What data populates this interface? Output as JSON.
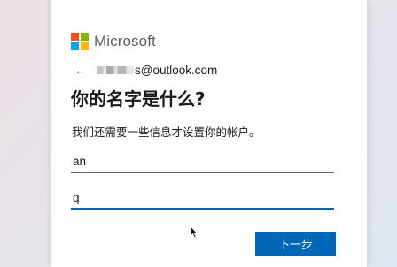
{
  "brand": {
    "name": "Microsoft",
    "logo_colors": [
      "#f25022",
      "#7fba00",
      "#00a4ef",
      "#ffb900"
    ]
  },
  "identity": {
    "back_icon": "←",
    "email_visible": "s@outlook.com"
  },
  "form": {
    "title": "你的名字是什么?",
    "subtitle": "我们还需要一些信息才设置你的帐户。",
    "last_name_value": "an",
    "first_name_value": "q"
  },
  "actions": {
    "next_label": "下一步"
  },
  "colors": {
    "accent": "#0067b8",
    "text": "#1b1b1b"
  },
  "icons": {
    "back": "back-arrow-icon",
    "logo": "microsoft-logo-icon",
    "pointer": "mouse-pointer-icon"
  }
}
